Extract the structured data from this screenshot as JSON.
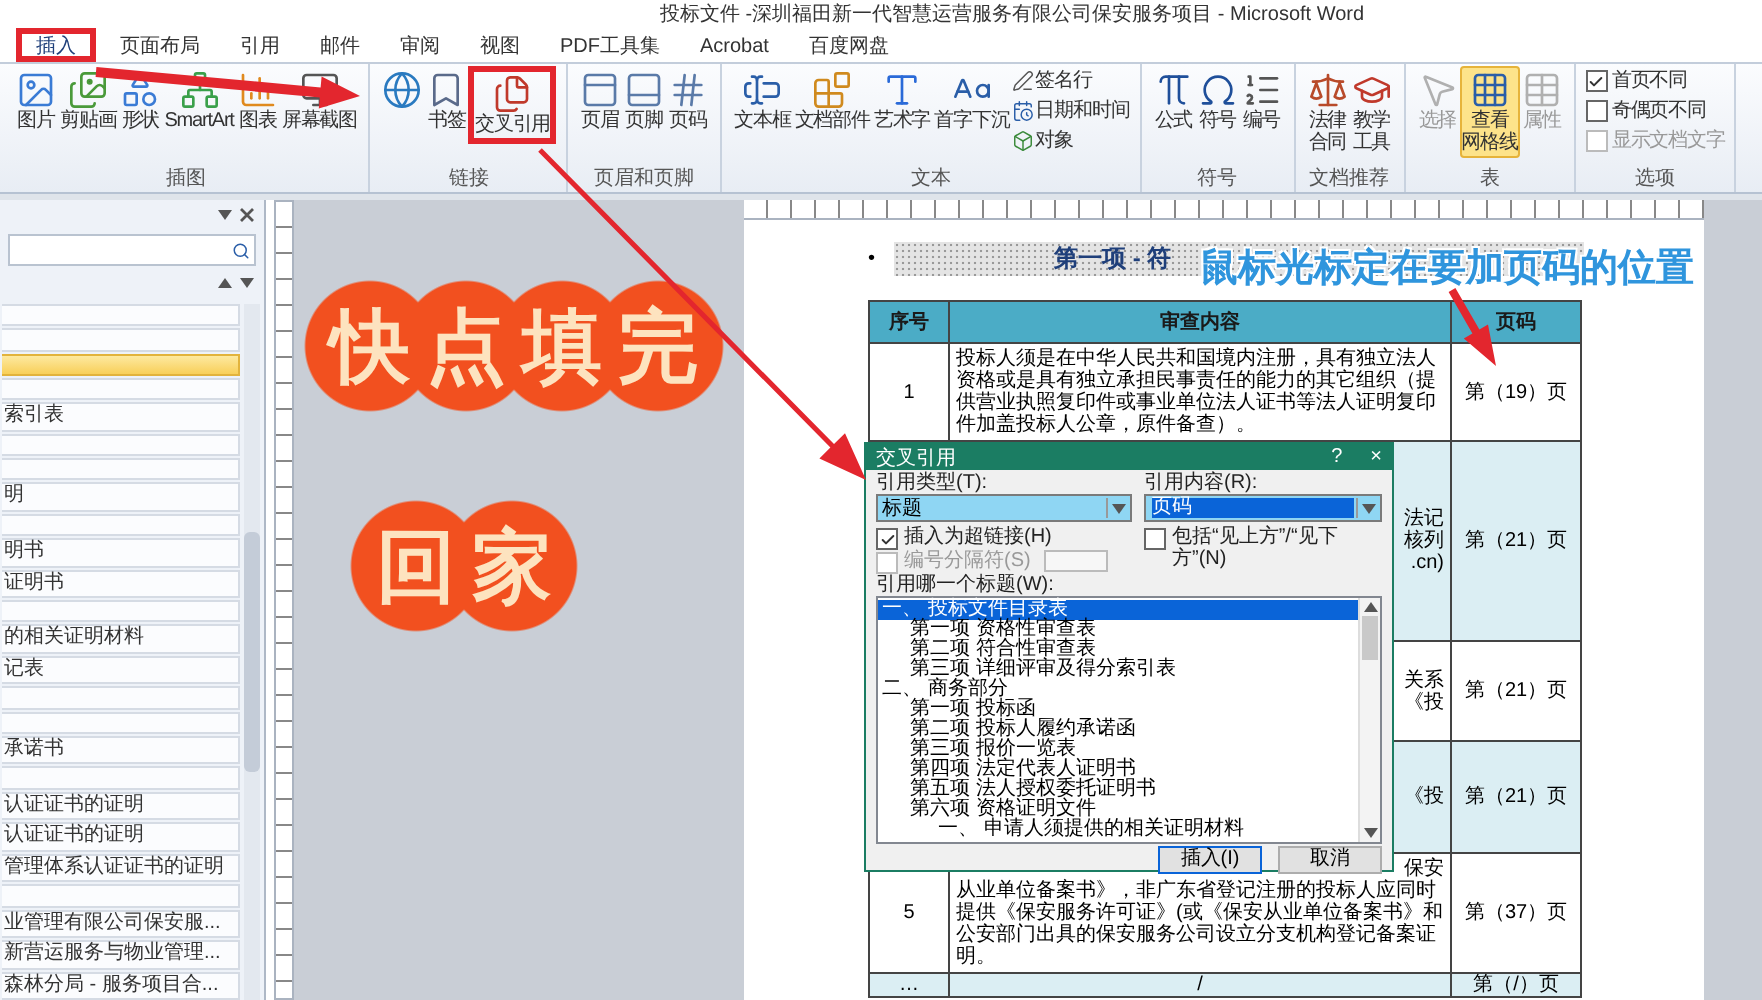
{
  "window": {
    "title": "投标文件 -深圳福田新一代智慧运营服务有限公司保安服务项目  -  Microsoft Word"
  },
  "tabs": [
    {
      "label": "插入",
      "selected": true,
      "highlighted": true
    },
    {
      "label": "页面布局",
      "selected": false,
      "highlighted": false
    },
    {
      "label": "引用",
      "selected": false,
      "highlighted": false
    },
    {
      "label": "邮件",
      "selected": false,
      "highlighted": false
    },
    {
      "label": "审阅",
      "selected": false,
      "highlighted": false
    },
    {
      "label": "视图",
      "selected": false,
      "highlighted": false
    },
    {
      "label": "PDF工具集",
      "selected": false,
      "highlighted": false
    },
    {
      "label": "Acrobat",
      "selected": false,
      "highlighted": false
    },
    {
      "label": "百度网盘",
      "selected": false,
      "highlighted": false
    }
  ],
  "ribbon": {
    "groups": [
      {
        "label": "插图",
        "items": [
          {
            "label": "图片"
          },
          {
            "label": "剪贴画"
          },
          {
            "label": "形状"
          },
          {
            "label": "SmartArt"
          },
          {
            "label": "图表"
          },
          {
            "label": "屏幕截图"
          }
        ]
      },
      {
        "label": "链接",
        "items": [
          {
            "highlighted": false
          },
          {
            "label": "书签",
            "highlighted": false
          },
          {
            "label": "交叉引用",
            "highlighted": true
          }
        ]
      },
      {
        "label": "页眉和页脚",
        "items": [
          {
            "label": "页眉"
          },
          {
            "label": "页脚"
          },
          {
            "label": "页码"
          }
        ]
      },
      {
        "label": "文本",
        "items": [
          {
            "label": "文本框"
          },
          {
            "label": "文档部件"
          },
          {
            "label": "艺术字"
          },
          {
            "label": "首字下沉"
          }
        ],
        "small_items": [
          {
            "label": "签名行"
          },
          {
            "label": "日期和时间"
          },
          {
            "label": "对象"
          }
        ]
      },
      {
        "label": "符号",
        "items": [
          {
            "label": "公式"
          },
          {
            "label": "符号"
          },
          {
            "label": "编号"
          }
        ]
      },
      {
        "label": "文档推荐",
        "items": [
          {
            "lines": [
              "法律",
              "合同"
            ]
          },
          {
            "lines": [
              "教学",
              "工具"
            ]
          }
        ]
      },
      {
        "label": "表",
        "items": [
          {
            "label": "选择",
            "on": false,
            "disabled": true
          },
          {
            "lines": [
              "查看",
              "网格线"
            ],
            "on": true,
            "disabled": false
          },
          {
            "label": "属性",
            "on": false,
            "disabled": true
          }
        ]
      },
      {
        "label": "选项",
        "checks": [
          {
            "label": "首页不同",
            "checked": true,
            "disabled": false
          },
          {
            "label": "奇偶页不同",
            "checked": false,
            "disabled": false
          },
          {
            "label": "显示文档文字",
            "checked": false,
            "disabled": true
          }
        ]
      }
    ]
  },
  "navigation": {
    "items": [
      {
        "selected": false
      },
      {
        "selected": false
      },
      {
        "selected": true
      },
      {
        "selected": false
      },
      {
        "label": "索引表",
        "selected": false
      },
      {
        "selected": false
      },
      {
        "selected": false
      },
      {
        "label": "明",
        "selected": false
      },
      {
        "selected": false
      },
      {
        "label": "明书",
        "selected": false
      },
      {
        "label": "证明书",
        "selected": false
      },
      {
        "selected": false
      },
      {
        "label": "的相关证明材料",
        "selected": false
      },
      {
        "label": "记表",
        "selected": false
      },
      {
        "selected": false
      },
      {
        "selected": false
      },
      {
        "label": "承诺书",
        "selected": false
      },
      {
        "selected": false
      },
      {
        "label": "认证证书的证明",
        "selected": false
      },
      {
        "label": "认证证书的证明",
        "selected": false
      },
      {
        "label": "管理体系认证证书的证明",
        "selected": false
      },
      {
        "selected": false
      },
      {
        "label": "业管理有限公司保安服...",
        "selected": false
      },
      {
        "label": "新营运服务与物业管理...",
        "selected": false
      },
      {
        "label": "森林分局 - 服务项目合...",
        "selected": false
      }
    ]
  },
  "document": {
    "bullet": "•",
    "heading": "第一项 - 符",
    "table": {
      "columns": [
        "序号",
        "审查内容",
        "页码"
      ],
      "rows": [
        {
          "number": "1",
          "content": "投标人须是在中华人民共和国境内注册，具有独立法人资格或是具有独立承担民事责任的能力的其它组织（提供营业执照复印件或事业单位法人证书等法人证明复印件加盖投标人公章，原件备查）。",
          "page": "第（19）页"
        },
        {
          "fragments": [
            "法记",
            "核列",
            ".cn)"
          ],
          "page": "第（21）页"
        },
        {
          "fragments": [
            "关系",
            "《投"
          ],
          "page": "第（21）页"
        },
        {
          "fragments": [
            "《投"
          ],
          "page": "第（21）页"
        },
        {
          "number": "5",
          "fragments": [
            "保安"
          ],
          "content": "从业单位备案书》，非广东省登记注册的投标人应同时提供《保安服务许可证》(或《保安从业单位备案书》和公安部门出具的保安服务公司设立分支机构登记备案证明。",
          "page": "第（37）页"
        },
        {
          "number": "…",
          "content": "/",
          "page": "第（/）页"
        }
      ]
    }
  },
  "dialog": {
    "title": "交叉引用",
    "help": "?",
    "close": "×",
    "type_field": {
      "label": "引用类型(T):",
      "value": "标题",
      "highlighted": true
    },
    "content_field": {
      "label": "引用内容(R):",
      "value": "页码",
      "highlighted": true
    },
    "checkboxes": [
      {
        "label": "插入为超链接(H)",
        "checked": true,
        "disabled": false
      },
      {
        "label": "编号分隔符(S)",
        "checked": false,
        "disabled": true
      },
      {
        "label": "包括“见上方”/“见下方”(N)",
        "checked": false,
        "disabled": false
      }
    ],
    "list_label": "引用哪一个标题(W):",
    "headings": [
      {
        "label": "一、 投标文件目录表",
        "selected": true,
        "children": [
          {
            "label": "第一项 资格性审查表",
            "selected": false
          },
          {
            "label": "第二项 符合性审查表",
            "selected": false
          },
          {
            "label": "第三项 详细评审及得分索引表",
            "selected": false
          }
        ]
      },
      {
        "label": "二、 商务部分",
        "selected": false,
        "children": [
          {
            "label": "第一项 投标函",
            "selected": false
          },
          {
            "label": "第二项 投标人履约承诺函",
            "selected": false
          },
          {
            "label": "第三项 报价一览表",
            "selected": false
          },
          {
            "label": "第四项 法定代表人证明书",
            "selected": false
          },
          {
            "label": "第五项 法人授权委托证明书",
            "selected": false
          },
          {
            "label": "第六项 资格证明文件",
            "selected": false,
            "children": [
              {
                "label": "一、 申请人须提供的相关证明材料",
                "selected": false
              }
            ]
          }
        ]
      }
    ],
    "buttons": [
      {
        "label": "插入(I)",
        "kind": "default"
      },
      {
        "label": "取消",
        "kind": "normal"
      }
    ]
  },
  "overlays": {
    "stickers": [
      "快点填完",
      "回家"
    ],
    "callout": "鼠标光标定在要加页码的位置"
  }
}
